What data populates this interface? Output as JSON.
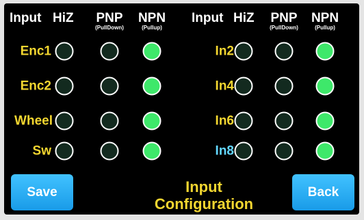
{
  "headers": {
    "left": {
      "input": "Input",
      "hiz": "HiZ",
      "pnp": "PNP",
      "pnp_sub": "(PullDown)",
      "npn": "NPN",
      "npn_sub": "(Pullup)"
    },
    "right": {
      "input": "Input",
      "hiz": "HiZ",
      "pnp": "PNP",
      "pnp_sub": "(PullDown)",
      "npn": "NPN",
      "npn_sub": "(Pullup)"
    }
  },
  "rows_left": [
    {
      "label": "Enc1",
      "selected": "npn",
      "label_color": "#f3d630"
    },
    {
      "label": "Enc2",
      "selected": "npn",
      "label_color": "#f3d630"
    },
    {
      "label": "Wheel",
      "selected": "npn",
      "label_color": "#f3d630"
    },
    {
      "label": "Sw",
      "selected": "npn",
      "label_color": "#f3d630"
    }
  ],
  "rows_right": [
    {
      "label": "In2",
      "selected": "npn",
      "label_color": "#f3d630"
    },
    {
      "label": "In4",
      "selected": "npn",
      "label_color": "#f3d630"
    },
    {
      "label": "In6",
      "selected": "npn",
      "label_color": "#f3d630"
    },
    {
      "label": "In8",
      "selected": "npn",
      "label_color": "#63d7ff"
    }
  ],
  "buttons": {
    "save": "Save",
    "back": "Back"
  },
  "title": {
    "line1": "Input",
    "line2": "Configuration"
  },
  "colors": {
    "accent_yellow": "#f3d630",
    "led_on": "#3ee86a",
    "led_off": "#132a1f",
    "button_blue": "#2aaef5",
    "highlight_cyan": "#63d7ff"
  }
}
